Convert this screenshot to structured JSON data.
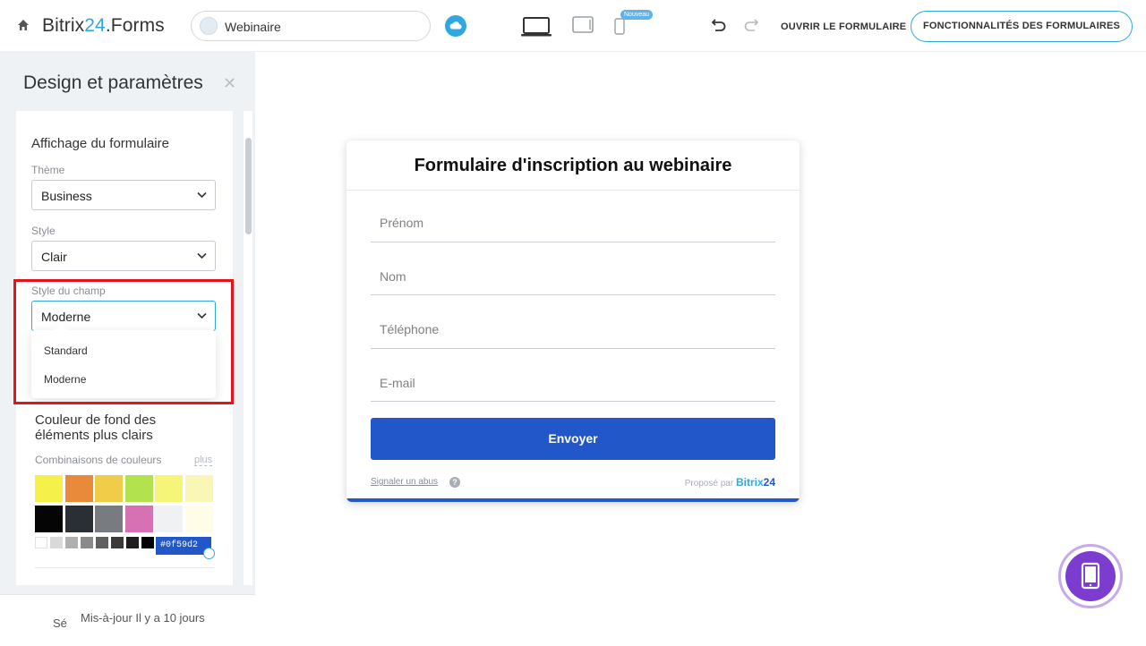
{
  "header": {
    "brand_prefix": "Bitrix",
    "brand_num": "24",
    "brand_suffix": ".Forms",
    "form_name": "Webinaire",
    "new_badge": "Nouveau",
    "open_form": "OUVRIR LE FORMULAIRE",
    "features": "FONCTIONNALITÉS DES FORMULAIRES"
  },
  "sidebar": {
    "title": "Design et paramètres",
    "section_title": "Affichage du formulaire",
    "theme_label": "Thème",
    "theme_value": "Business",
    "style_label": "Style",
    "style_value": "Clair",
    "field_style_label": "Style du champ",
    "field_style_value": "Moderne",
    "field_style_options": [
      "Standard",
      "Moderne"
    ],
    "bg_title": "Couleur de fond des éléments plus clairs",
    "combos_label": "Combinaisons de couleurs",
    "combos_more": "plus",
    "selected_hex": "#0f59d2",
    "swatches_row1": [
      "#f5f04a",
      "#e98a3a",
      "#f0cd48",
      "#b2e24e",
      "#f5f578",
      "#f9f6b6"
    ],
    "swatches_row2": [
      "#050505",
      "#2a2f36",
      "#787c80",
      "#d672b4",
      "#f0f1f2",
      "#fffde8"
    ],
    "swatches_small": [
      "#ffffff",
      "#d9d9d9",
      "#b0b0b0",
      "#8a8a8a",
      "#606060",
      "#3a3a3a",
      "#1e1e1e",
      "#000000"
    ]
  },
  "footer": {
    "se": "Sé",
    "updated": "Mis-à-jour Il y a 10 jours"
  },
  "form": {
    "title": "Formulaire d'inscription au webinaire",
    "fields": [
      "Prénom",
      "Nom",
      "Téléphone",
      "E-mail"
    ],
    "submit": "Envoyer",
    "abuse": "Signaler un abus",
    "help": "?",
    "powered_by": "Proposé par",
    "powered_brand": "Bitrix",
    "powered_num": "24",
    "accent": "#2157c9"
  }
}
